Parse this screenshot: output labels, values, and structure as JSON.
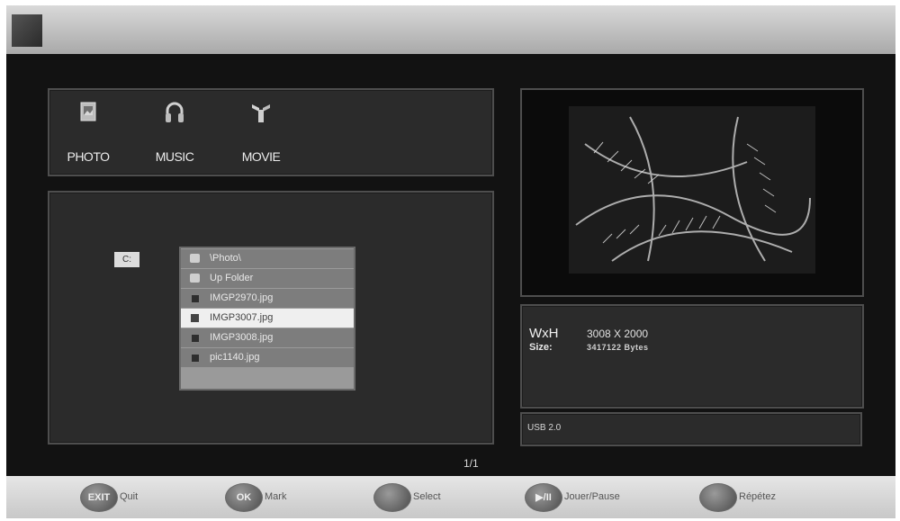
{
  "tabs": [
    {
      "label": "PHOTO",
      "icon": "photo-icon"
    },
    {
      "label": "MUSIC",
      "icon": "headphones-icon"
    },
    {
      "label": "MOVIE",
      "icon": "movie-icon"
    }
  ],
  "browser": {
    "drive": "C:",
    "files": [
      {
        "name": "\\Photo\\",
        "type": "folder",
        "icon": "folder-icon",
        "selected": false
      },
      {
        "name": "Up Folder",
        "type": "folder",
        "icon": "up-folder-icon",
        "selected": false
      },
      {
        "name": "IMGP2970.jpg",
        "type": "file",
        "icon": "file-icon",
        "selected": false
      },
      {
        "name": "IMGP3007.jpg",
        "type": "file",
        "icon": "image-file-icon",
        "selected": true
      },
      {
        "name": "IMGP3008.jpg",
        "type": "file",
        "icon": "file-icon",
        "selected": false
      },
      {
        "name": "pic1140.jpg",
        "type": "file",
        "icon": "file-icon",
        "selected": false
      }
    ],
    "page": "1/1"
  },
  "info": {
    "wh_label": "WxH",
    "wh_value": "3008 X 2000",
    "size_label": "Size:",
    "size_value": "3417122 Bytes"
  },
  "device": "USB 2.0",
  "hints": [
    {
      "key": "EXIT",
      "label": "Quit"
    },
    {
      "key": "OK",
      "label": "Mark"
    },
    {
      "key": "",
      "label": "Select"
    },
    {
      "key": "▶/II",
      "label": "Jouer/Pause"
    },
    {
      "key": "",
      "label": "Répétez"
    }
  ],
  "colors": {
    "background": "#121212",
    "panel": "#2b2b2b",
    "selected_row": "#efefef"
  }
}
